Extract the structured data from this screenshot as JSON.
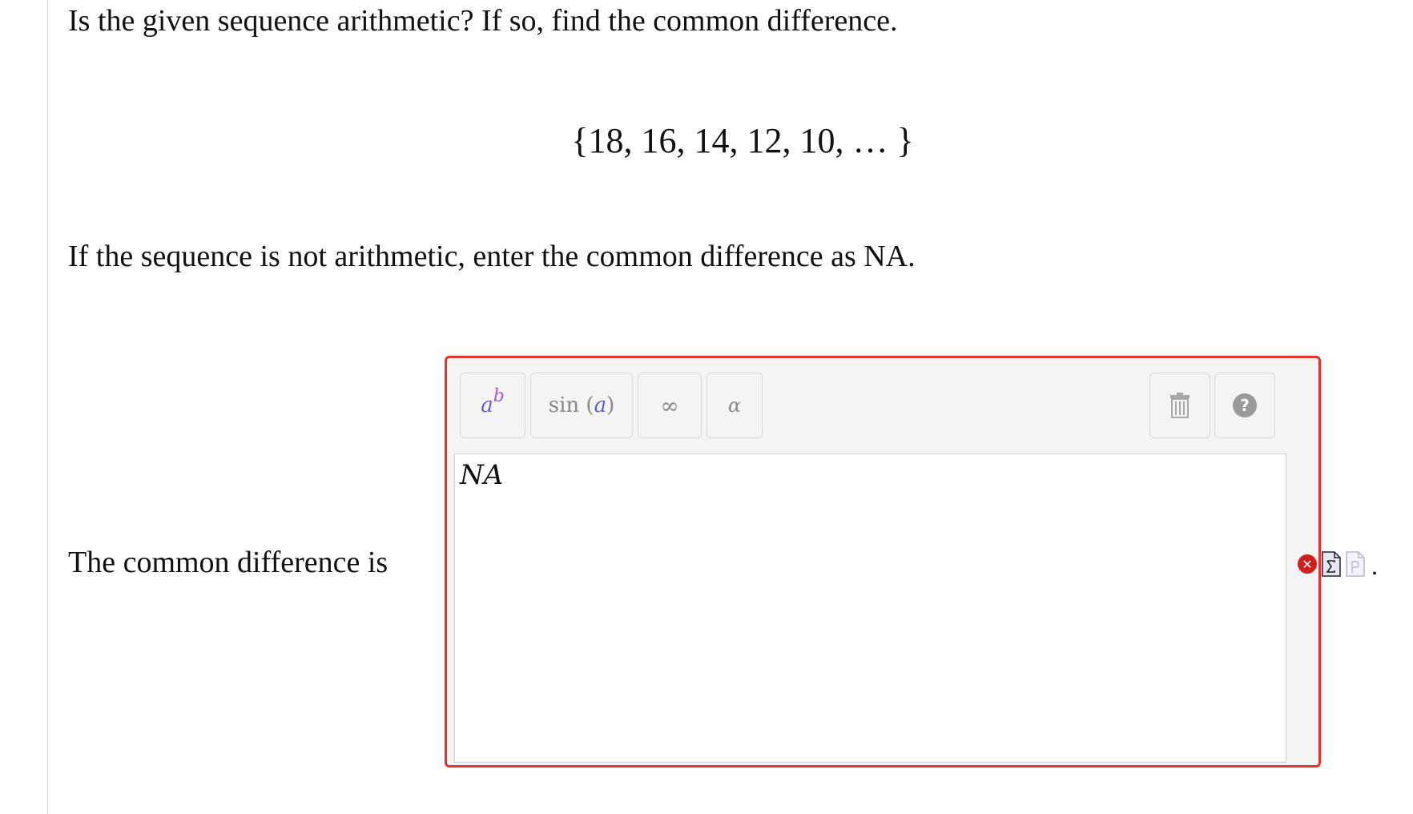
{
  "question": {
    "text": "Is the given sequence arithmetic? If so, find the common difference.",
    "sequence": "{18, 16, 14, 12, 10, … }",
    "instruction": "If the sequence is not arithmetic, enter the common difference as NA."
  },
  "answer": {
    "prompt": "The common difference is",
    "value": "NA",
    "status": "incorrect",
    "trailing_punctuation": "."
  },
  "editor": {
    "border_color": "#e2342a",
    "toolbar": {
      "power_base": "a",
      "power_exponent": "b",
      "trig_func": "sin",
      "trig_open": "(",
      "trig_arg": "a",
      "trig_close": ")",
      "infinity": "∞",
      "greek": "α"
    },
    "buttons": {
      "clear_icon": "trash-icon",
      "help_icon": "help-icon",
      "help_glyph": "?"
    }
  },
  "status_icons": [
    "error-icon",
    "equation-document-icon",
    "preview-document-icon"
  ],
  "colors": {
    "error": "#cf1f1f",
    "power_base": "#6a5acd",
    "power_exponent": "#a65fc7",
    "trig_arg": "#5b5fd6"
  }
}
